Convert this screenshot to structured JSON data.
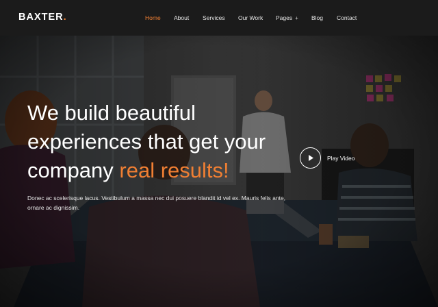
{
  "brand": {
    "name": "BAXTER",
    "dot": "."
  },
  "nav": {
    "items": [
      {
        "label": "Home",
        "active": true
      },
      {
        "label": "About"
      },
      {
        "label": "Services"
      },
      {
        "label": "Our Work"
      },
      {
        "label": "Pages",
        "has_submenu": true,
        "submenu_symbol": "+"
      },
      {
        "label": "Blog"
      },
      {
        "label": "Contact"
      }
    ]
  },
  "hero": {
    "title_line1": "We build beautiful",
    "title_line2": "experiences that get your",
    "title_line3_plain": "company ",
    "title_line3_accent": "real results!",
    "description": "Donec ac scelerisque lacus. Vestibulum a massa nec dui posuere blandit id vel ex. Mauris felis ante, ornare ac dignissim.",
    "play_label": "Play Video",
    "play_icon": "play-icon"
  },
  "colors": {
    "accent": "#f07f33",
    "header_bg": "#1b1b1b",
    "text": "#ffffff"
  }
}
